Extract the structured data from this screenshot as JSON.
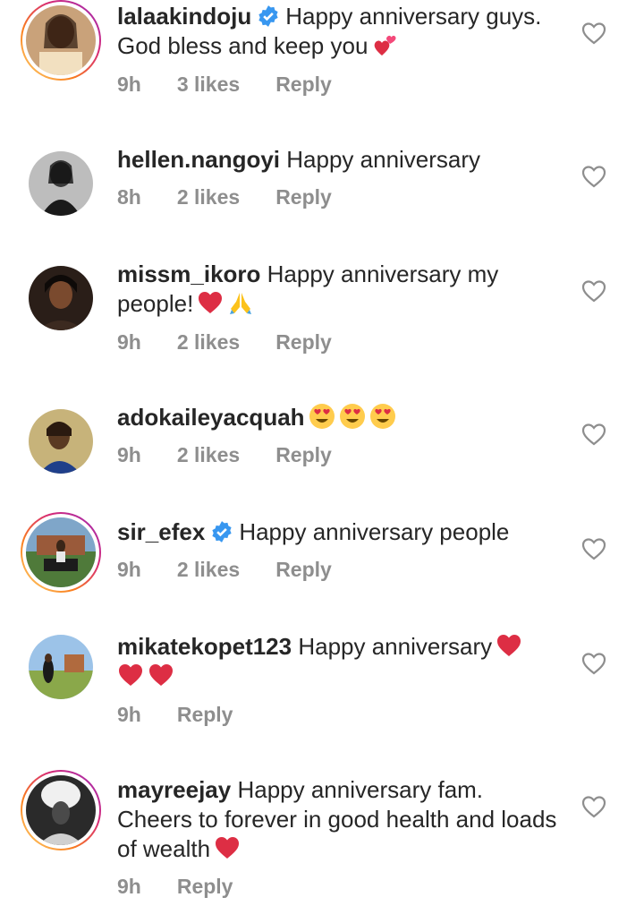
{
  "comments": [
    {
      "username": "lalaakindoju",
      "verified": true,
      "text": "Happy anniversary guys. God bless and keep you",
      "emojis": [
        "two-hearts"
      ],
      "time": "9h",
      "likes": "3 likes",
      "reply": "Reply",
      "story_ring": true
    },
    {
      "username": "hellen.nangoyi",
      "verified": false,
      "text": "Happy anniversary",
      "emojis": [],
      "time": "8h",
      "likes": "2 likes",
      "reply": "Reply",
      "story_ring": false
    },
    {
      "username": "missm_ikoro",
      "verified": false,
      "text": "Happy anniversary my people!",
      "emojis": [
        "red-heart",
        "folded-hands"
      ],
      "time": "9h",
      "likes": "2 likes",
      "reply": "Reply",
      "story_ring": false
    },
    {
      "username": "adokaileyacquah",
      "verified": false,
      "text": "",
      "emojis": [
        "heart-eyes",
        "heart-eyes",
        "heart-eyes"
      ],
      "time": "9h",
      "likes": "2 likes",
      "reply": "Reply",
      "story_ring": false
    },
    {
      "username": "sir_efex",
      "verified": true,
      "text": "Happy anniversary people",
      "emojis": [],
      "time": "9h",
      "likes": "2 likes",
      "reply": "Reply",
      "story_ring": true
    },
    {
      "username": "mikatekopet123",
      "verified": false,
      "text": "Happy anniversary",
      "emojis": [
        "red-heart",
        "red-heart",
        "red-heart"
      ],
      "time": "9h",
      "likes": "",
      "reply": "Reply",
      "story_ring": false
    },
    {
      "username": "mayreejay",
      "verified": false,
      "text": "Happy anniversary fam. Cheers to forever in good health and loads of wealth",
      "emojis": [
        "red-heart"
      ],
      "time": "9h",
      "likes": "",
      "reply": "Reply",
      "story_ring": true
    }
  ],
  "colors": {
    "text": "#262626",
    "meta": "#8e8e8e",
    "verified": "#3897f0",
    "heart": "#e0245e"
  },
  "icons": {
    "like": "heart-outline-icon",
    "verified": "verified-badge-icon"
  }
}
